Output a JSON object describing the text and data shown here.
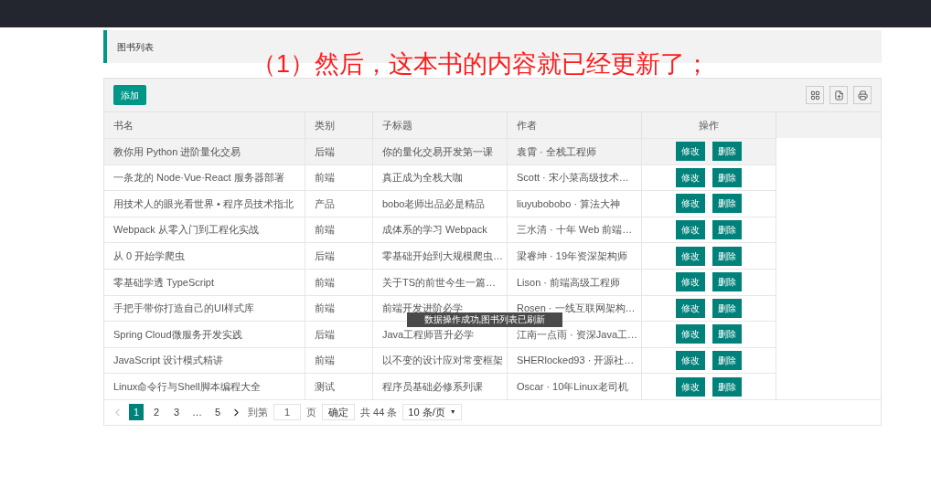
{
  "header": {
    "title": "图书列表"
  },
  "caption": "（1）然后，这本书的内容就已经更新了；",
  "toolbar": {
    "add_button": "添加"
  },
  "table": {
    "columns": [
      "书名",
      "类别",
      "子标题",
      "作者",
      "操作"
    ],
    "rows": [
      {
        "title": "教你用 Python 进阶量化交易",
        "category": "后端",
        "subtitle": "你的量化交易开发第一课",
        "author": "袁霄 · 全栈工程师",
        "actions": [
          "修改",
          "删除"
        ],
        "selected": true
      },
      {
        "title": "一条龙的 Node·Vue·React 服务器部署",
        "category": "前端",
        "subtitle": "真正成为全栈大咖",
        "author": "Scott · 宋小菜高级技术…",
        "actions": [
          "修改",
          "删除"
        ],
        "selected": false
      },
      {
        "title": "用技术人的眼光看世界 • 程序员技术指北",
        "category": "产品",
        "subtitle": "bobo老师出品必是精品",
        "author": "liuyubobobo · 算法大神",
        "actions": [
          "修改",
          "删除"
        ],
        "selected": false
      },
      {
        "title": "Webpack 从零入门到工程化实战",
        "category": "前端",
        "subtitle": "成体系的学习 Webpack",
        "author": "三水清 · 十年 Web 前端…",
        "actions": [
          "修改",
          "删除"
        ],
        "selected": false
      },
      {
        "title": "从 0 开始学爬虫",
        "category": "后端",
        "subtitle": "零基础开始到大规模爬虫…",
        "author": "梁睿坤 · 19年资深架构师",
        "actions": [
          "修改",
          "删除"
        ],
        "selected": false
      },
      {
        "title": "零基础学透 TypeScript",
        "category": "前端",
        "subtitle": "关于TS的前世今生一篇…",
        "author": "Lison · 前端高级工程师",
        "actions": [
          "修改",
          "删除"
        ],
        "selected": false
      },
      {
        "title": "手把手带你打造自己的UI样式库",
        "category": "前端",
        "subtitle": "前端开发进阶必学",
        "author": "Rosen · 一线互联网架构…",
        "actions": [
          "修改",
          "删除"
        ],
        "selected": false
      },
      {
        "title": "Spring Cloud微服务开发实践",
        "category": "后端",
        "subtitle": "Java工程师晋升必学",
        "author": "江南一点雨 · 资深Java工…",
        "actions": [
          "修改",
          "删除"
        ],
        "selected": false
      },
      {
        "title": "JavaScript 设计模式精讲",
        "category": "前端",
        "subtitle": "以不变的设计应对常变框架",
        "author": "SHERlocked93 · 开源社…",
        "actions": [
          "修改",
          "删除"
        ],
        "selected": false
      },
      {
        "title": "Linux命令行与Shell脚本编程大全",
        "category": "测试",
        "subtitle": "程序员基础必修系列课",
        "author": "Oscar · 10年Linux老司机",
        "actions": [
          "修改",
          "删除"
        ],
        "selected": false
      }
    ]
  },
  "pagination": {
    "pages": [
      {
        "label": "1",
        "selected": true
      },
      {
        "label": "2",
        "selected": false
      },
      {
        "label": "3",
        "selected": false
      },
      {
        "label": "…",
        "selected": false
      },
      {
        "label": "5",
        "selected": false
      }
    ],
    "goto_label": "到第",
    "page_value": "1",
    "page_unit": "页",
    "confirm": "确定",
    "total": "共 44 条",
    "page_size": "10 条/页",
    "page_size_caret": "▼"
  },
  "toast": "数据操作成功,图书列表已刷新"
}
